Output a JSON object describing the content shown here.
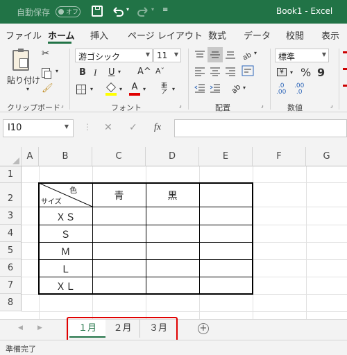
{
  "titlebar": {
    "autosave_label": "自動保存",
    "autosave_state": "オフ",
    "save_icon": "save-icon",
    "undo_icon": "undo-icon",
    "redo_icon": "redo-icon",
    "customize_icon": "dropdown-icon",
    "doc_title": "Book1 - Excel",
    "bg_color": "#217346"
  },
  "menu": {
    "items": [
      "ファイル",
      "ホーム",
      "挿入",
      "ページ レイアウト",
      "数式",
      "データ",
      "校閲",
      "表示"
    ],
    "active": "ホーム"
  },
  "ribbon": {
    "clipboard": {
      "paste_label": "貼り付け",
      "group_label": "クリップボード"
    },
    "font": {
      "font_name": "游ゴシック",
      "font_size": "11",
      "bold": "B",
      "italic": "I",
      "underline": "U",
      "grow": "A^",
      "shrink": "Aˇ",
      "font_color_letter": "A",
      "group_label": "フォント"
    },
    "alignment": {
      "group_label": "配置"
    },
    "number": {
      "format": "標準",
      "percent": "%",
      "comma": "9",
      "group_label": "数値"
    }
  },
  "formula_bar": {
    "name_box": "I10",
    "fx_label": "fx",
    "cancel": "✕",
    "confirm": "✓",
    "formula": ""
  },
  "sheet": {
    "columns": [
      "A",
      "B",
      "C",
      "D",
      "E",
      "F",
      "G"
    ],
    "rows": [
      "1",
      "2",
      "3",
      "4",
      "5",
      "6",
      "7",
      "8"
    ],
    "table": {
      "diag_top": "色",
      "diag_bottom": "サイズ",
      "headers": [
        "青",
        "黒",
        ""
      ],
      "sizes": [
        "ＸＳ",
        "Ｓ",
        "Ｍ",
        "Ｌ",
        "ＸＬ"
      ]
    }
  },
  "sheet_tabs": {
    "tabs": [
      "１月",
      "２月",
      "３月"
    ],
    "active": "１月",
    "add_label": "+",
    "highlight_color": "#e00000"
  },
  "status": {
    "text": "準備完了"
  }
}
